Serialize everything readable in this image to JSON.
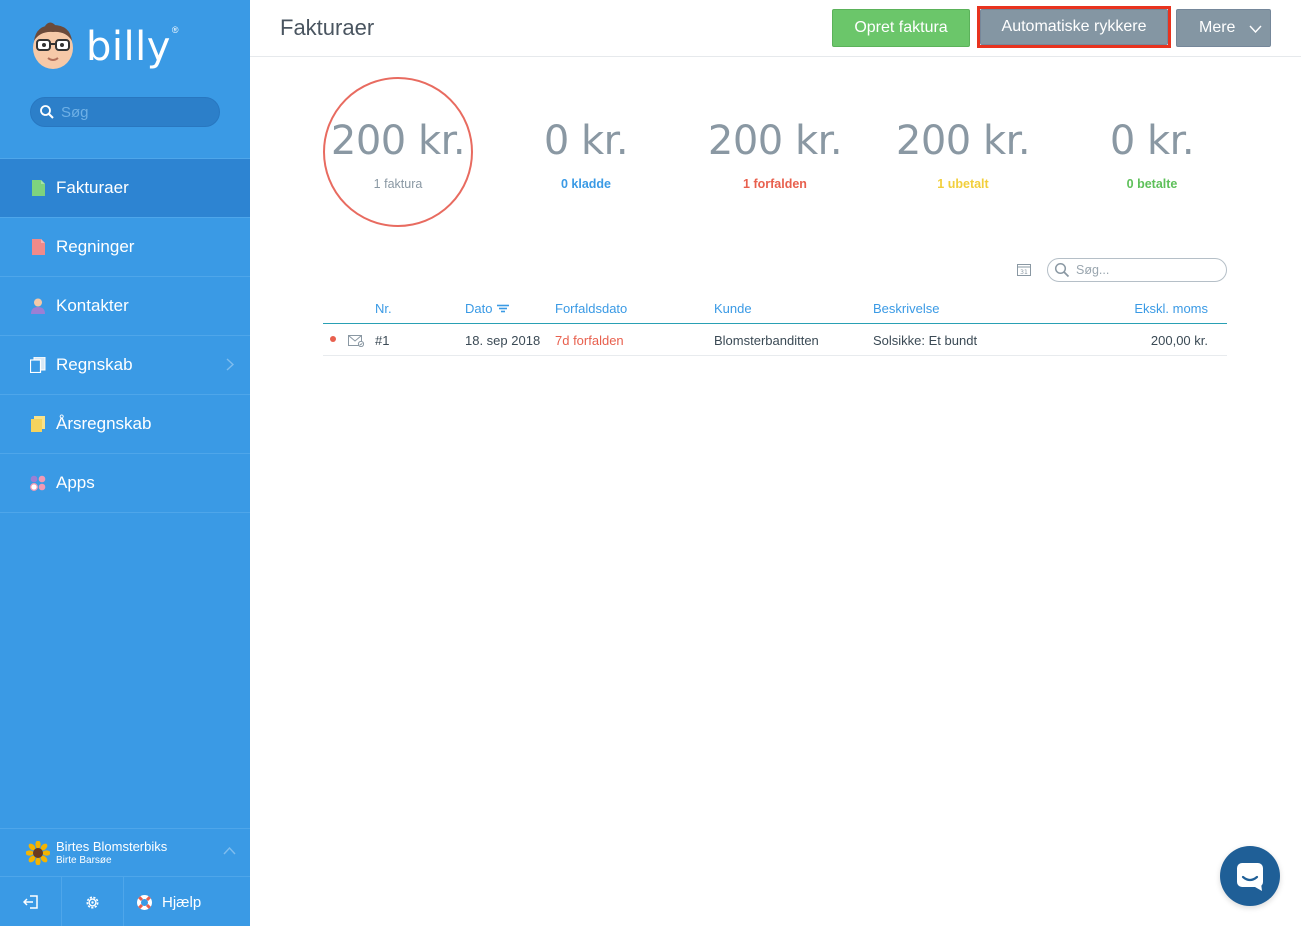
{
  "app": {
    "logo_text": "billy",
    "logo_reg": "®"
  },
  "sidebar": {
    "search_placeholder": "Søg",
    "items": [
      {
        "label": "Fakturaer",
        "icon": "invoice-doc-icon",
        "color": "#7ed37e",
        "active": true
      },
      {
        "label": "Regninger",
        "icon": "bill-doc-icon",
        "color": "#f08a8a"
      },
      {
        "label": "Kontakter",
        "icon": "person-icon",
        "color": "#9b7fd4"
      },
      {
        "label": "Regnskab",
        "icon": "ledger-icon",
        "color": "#d8e8f5"
      },
      {
        "label": "Årsregnskab",
        "icon": "annual-report-icon",
        "color": "#f4d35e"
      },
      {
        "label": "Apps",
        "icon": "apps-icon",
        "color": "#f09ab5"
      }
    ],
    "company_name": "Birtes Blomsterbiks",
    "user_name": "Birte Barsøe",
    "help_label": "Hjælp"
  },
  "header": {
    "title": "Fakturaer",
    "create_button": "Opret faktura",
    "auto_reminders_button": "Automatiske rykkere",
    "more_button": "Mere"
  },
  "stats": [
    {
      "amount": "200 kr.",
      "label": "1 faktura",
      "color": "#8a98a3"
    },
    {
      "amount": "0 kr.",
      "label": "0 kladde",
      "color": "#3a9ae5"
    },
    {
      "amount": "200 kr.",
      "label": "1 forfalden",
      "color": "#e8604e"
    },
    {
      "amount": "200 kr.",
      "label": "1 ubetalt",
      "color": "#f2cf3c"
    },
    {
      "amount": "0 kr.",
      "label": "0 betalte",
      "color": "#5ec05a"
    }
  ],
  "table": {
    "search_placeholder": "Søg...",
    "columns": {
      "nr": "Nr.",
      "date": "Dato",
      "due": "Forfaldsdato",
      "customer": "Kunde",
      "description": "Beskrivelse",
      "excl_vat": "Ekskl. moms"
    },
    "rows": [
      {
        "nr": "#1",
        "date": "18. sep 2018",
        "due": "7d forfalden",
        "customer": "Blomsterbanditten",
        "description": "Solsikke: Et bundt",
        "amount": "200,00 kr."
      }
    ]
  }
}
